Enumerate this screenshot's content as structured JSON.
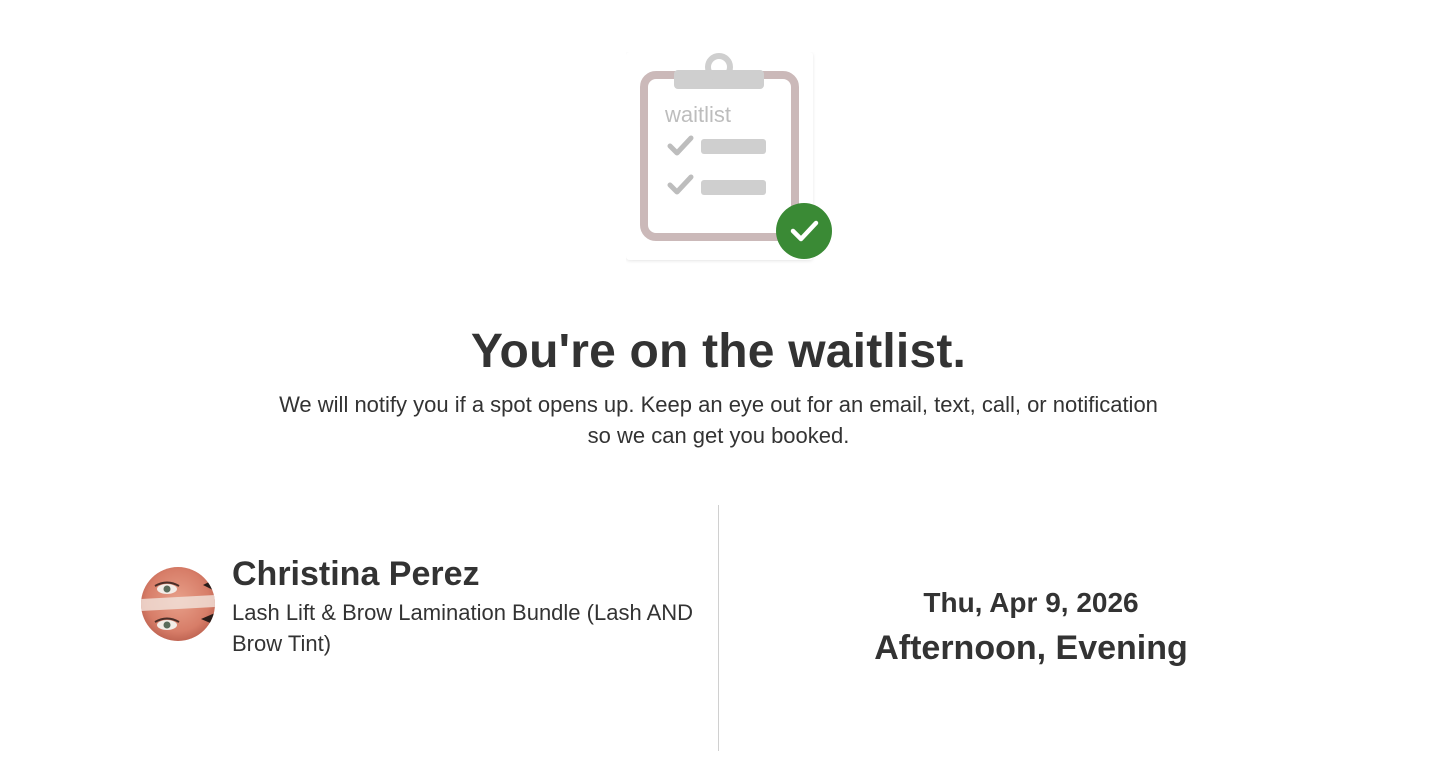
{
  "illustration": {
    "clipboard_label": "waitlist",
    "clipboard_color": "#cbb9b9",
    "check_badge_color": "#3a8a35"
  },
  "confirmation": {
    "headline": "You're on the waitlist.",
    "message": "We will notify you if a spot opens up. Keep an eye out for an email, text, call, or notification so we can get you booked."
  },
  "booking": {
    "provider_name": "Christina Perez",
    "service_name": "Lash Lift & Brow Lamination Bundle (Lash AND Brow Tint)",
    "date": "Thu, Apr 9, 2026",
    "time_window": "Afternoon, Evening"
  },
  "colors": {
    "text": "#333333",
    "divider": "#d0d0d0"
  }
}
